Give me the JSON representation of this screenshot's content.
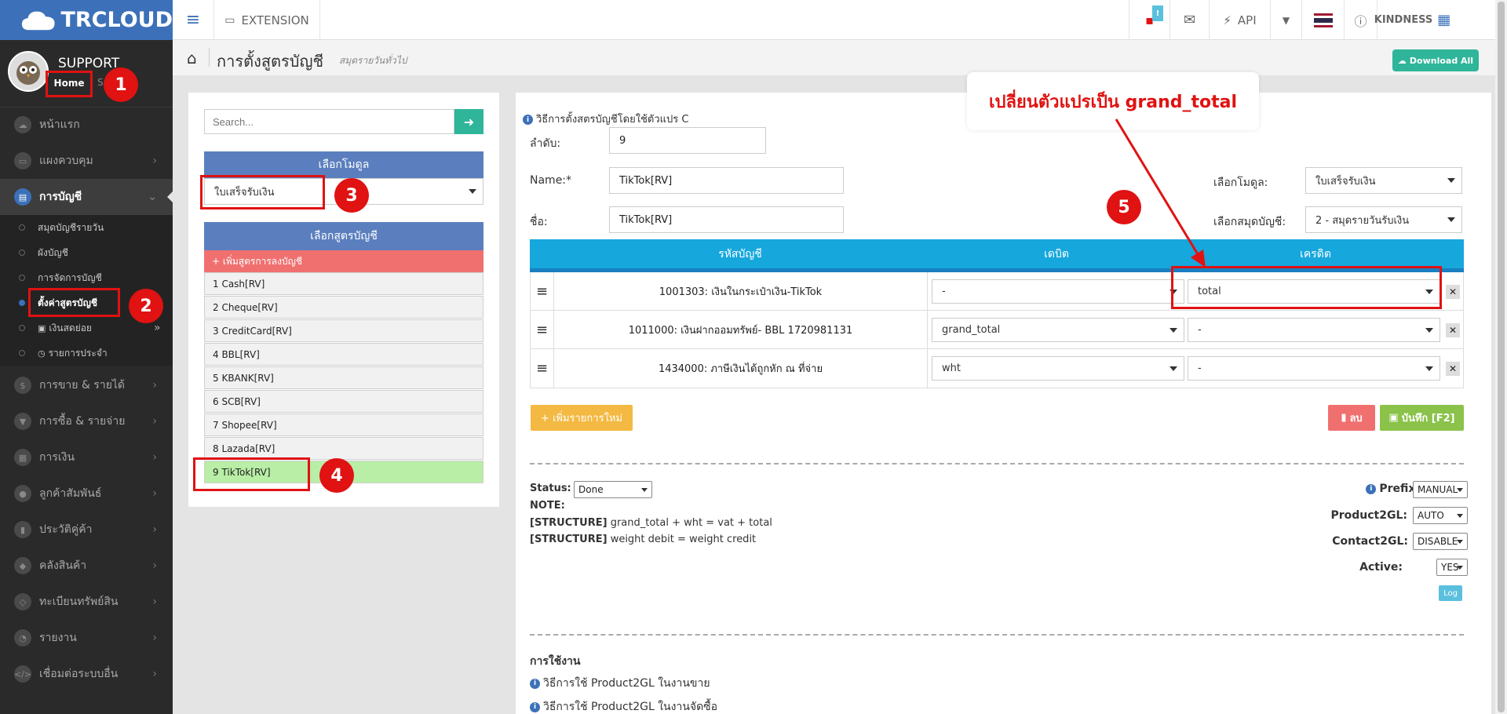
{
  "brand": {
    "name": "TRCLOUD"
  },
  "profile": {
    "name": "SUPPORT",
    "home": "Home",
    "extra": "S"
  },
  "sidebar": {
    "items": [
      {
        "label": "หน้าแรก"
      },
      {
        "label": "แผงควบคุม"
      },
      {
        "label": "การบัญชี"
      },
      {
        "label": "การขาย & รายได้"
      },
      {
        "label": "การซื้อ & รายจ่าย"
      },
      {
        "label": "การเงิน"
      },
      {
        "label": "ลูกค้าสัมพันธ์"
      },
      {
        "label": "ประวัติคู่ค้า"
      },
      {
        "label": "คลังสินค้า"
      },
      {
        "label": "ทะเบียนทรัพย์สิน"
      },
      {
        "label": "รายงาน"
      },
      {
        "label": "เชื่อมต่อระบบอื่น"
      }
    ],
    "sub_items": [
      {
        "label": "สมุดบัญชีรายวัน"
      },
      {
        "label": "ผังบัญชี"
      },
      {
        "label": "การจัดการบัญชี"
      },
      {
        "label": "ตั้งค่าสูตรบัญชี"
      },
      {
        "label": "เงินสดย่อย"
      },
      {
        "label": "รายการประจำ"
      }
    ]
  },
  "topbar": {
    "extension": "EXTENSION",
    "api": "API",
    "company": "KINDNESS",
    "notif_count": "!"
  },
  "header": {
    "title": "การตั้งสูตรบัญชี",
    "subtitle": "สมุดรายวันทั่วไป",
    "download_all": "Download All"
  },
  "left_panel": {
    "search_placeholder": "Search...",
    "module_header": "เลือกโมดูล",
    "module_value": "ใบเสร็จรับเงิน",
    "formula_header": "เลือกสูตรบัญชี",
    "add_formula": "+ เพิ่มสูตรการลงบัญชี",
    "formulas": [
      {
        "label": "1 Cash[RV]"
      },
      {
        "label": "2 Cheque[RV]"
      },
      {
        "label": "3 CreditCard[RV]"
      },
      {
        "label": "4 BBL[RV]"
      },
      {
        "label": "5 KBANK[RV]"
      },
      {
        "label": "6 SCB[RV]"
      },
      {
        "label": "7 Shopee[RV]"
      },
      {
        "label": "8 Lazada[RV]"
      },
      {
        "label": "9 TikTok[RV]"
      }
    ]
  },
  "form": {
    "info": "วิธีการตั้งสตรบัญชีโดยใช้ตัวแปร C",
    "order_label": "ลำดับ:",
    "order_value": "9",
    "name_label": "Name:*",
    "name_value": "TikTok[RV]",
    "thai_name_label": "ชื่อ:",
    "thai_name_value": "TikTok[RV]",
    "module_label": "เลือกโมดูล:",
    "module_value": "ใบเสร็จรับเงิน",
    "book_label": "เลือกสมุดบัญชี:",
    "book_value": "2 - สมุดรายวันรับเงิน"
  },
  "table": {
    "headers": {
      "account": "รหัสบัญชี",
      "debit": "เดบิต",
      "credit": "เครดิต"
    },
    "rows": [
      {
        "account": "1001303: เงินในกระเป๋าเงิน-TikTok",
        "debit": "-",
        "credit": "total"
      },
      {
        "account": "1011000: เงินฝากออมทรัพย์- BBL 1720981131",
        "debit": "grand_total",
        "credit": "-"
      },
      {
        "account": "1434000: ภาษีเงินได้ถูกหัก ณ ที่จ่าย",
        "debit": "wht",
        "credit": "-"
      }
    ]
  },
  "actions": {
    "add_row": "+ เพิ่มรายการใหม่",
    "delete": "ลบ",
    "save": "บันทึก [F2]"
  },
  "status": {
    "label": "Status:",
    "value": "Done",
    "note_label": "NOTE:",
    "structure_tag": "[STRUCTURE]",
    "structure1": "grand_total + wht = vat + total",
    "structure2": "weight debit = weight credit"
  },
  "settings": {
    "prefix_label": "Prefix:",
    "prefix_value": "MANUAL",
    "p2gl_label": "Product2GL:",
    "p2gl_value": "AUTO",
    "c2gl_label": "Contact2GL:",
    "c2gl_value": "DISABLE",
    "active_label": "Active:",
    "active_value": "YES",
    "log": "Log"
  },
  "usage": {
    "title": "การใช้งาน",
    "link1": "วิธีการใช้ Product2GL ในงานขาย",
    "link2": "วิธีการใช้ Product2GL ในงานจัดซื้อ"
  },
  "annotations": {
    "callout": "เปลี่ยนตัวแปรเป็น grand_total",
    "badges": [
      "1",
      "2",
      "3",
      "4",
      "5"
    ]
  },
  "colors": {
    "brand_blue": "#3c71b9",
    "teal": "#2fb59a",
    "table_header": "#16a7dd",
    "annotation_red": "#e01212",
    "active_row": "#b8eea6"
  }
}
